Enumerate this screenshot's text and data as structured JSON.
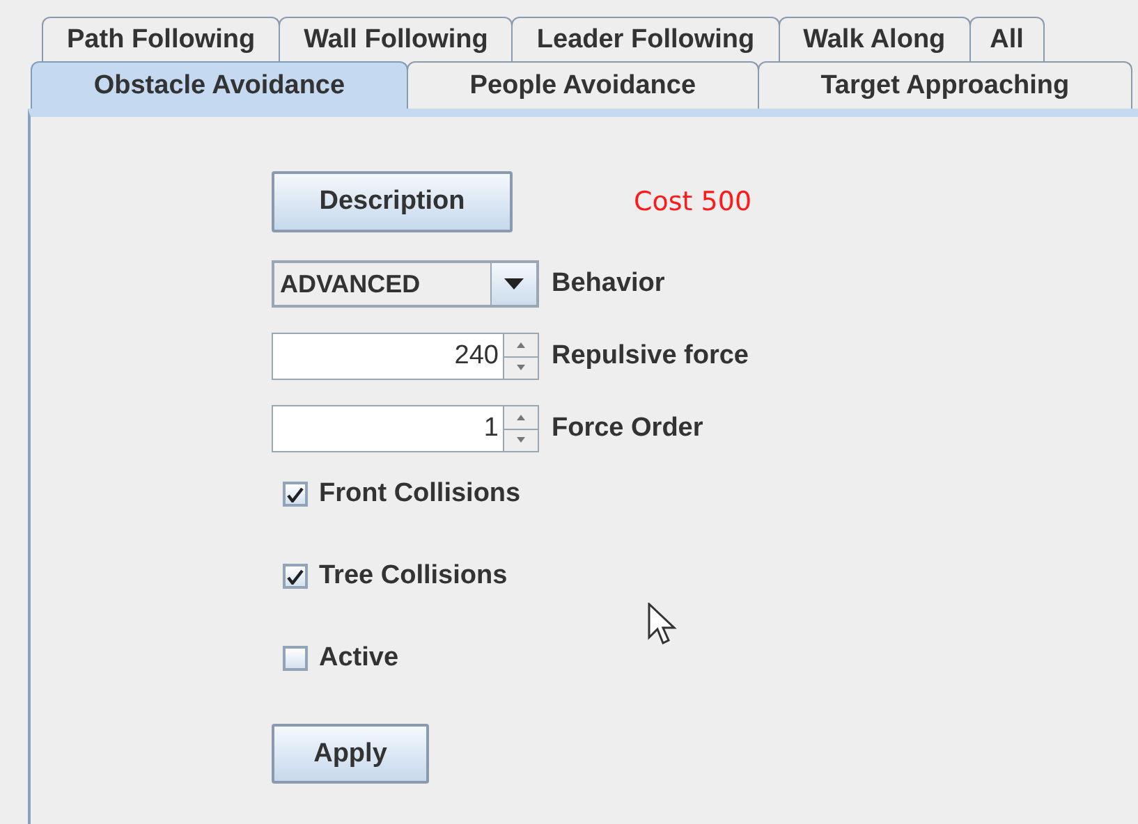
{
  "tab_rows": [
    {
      "tabs": [
        {
          "label": "Path Following",
          "selected": false
        },
        {
          "label": "Wall Following",
          "selected": false
        },
        {
          "label": "Leader Following",
          "selected": false
        },
        {
          "label": "Walk Along",
          "selected": false
        },
        {
          "label": "All",
          "selected": false
        }
      ]
    },
    {
      "tabs": [
        {
          "label": "Obstacle Avoidance",
          "selected": true
        },
        {
          "label": "People Avoidance",
          "selected": false
        },
        {
          "label": "Target Approaching",
          "selected": false
        }
      ]
    }
  ],
  "description_button": "Description",
  "cost": "Cost 500",
  "behavior": {
    "value": "ADVANCED",
    "label": "Behavior"
  },
  "spinners": [
    {
      "value": "240",
      "label": "Repulsive force"
    },
    {
      "value": "1",
      "label": "Force Order"
    }
  ],
  "checkboxes": [
    {
      "label": "Front Collisions",
      "checked": true
    },
    {
      "label": "Tree Collisions",
      "checked": true
    },
    {
      "label": "Active",
      "checked": false
    }
  ],
  "apply_button": "Apply"
}
